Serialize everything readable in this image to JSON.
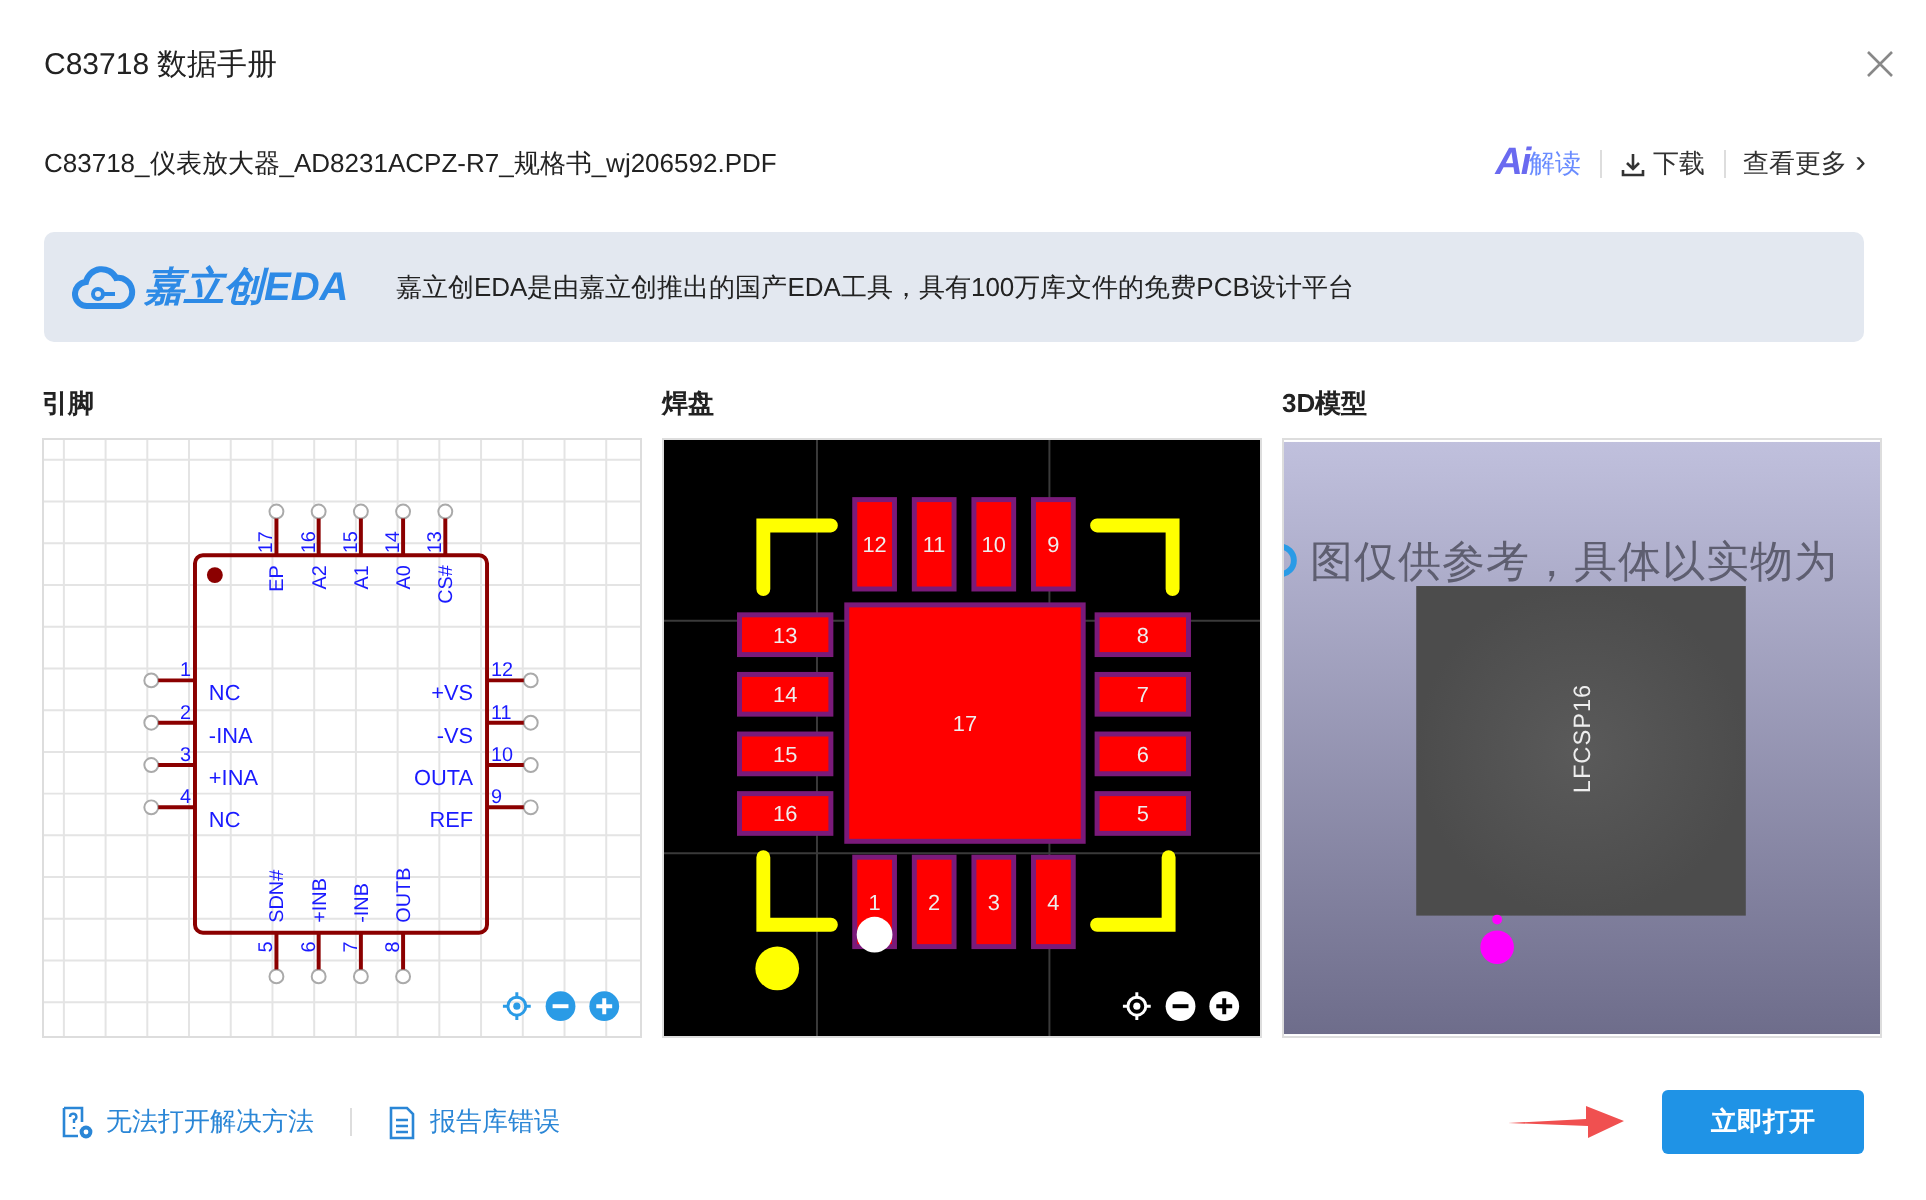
{
  "dialog": {
    "title": "C83718 数据手册"
  },
  "file": {
    "name": "C83718_仪表放大器_AD8231ACPZ-R7_规格书_wj206592.PDF",
    "actions": [
      {
        "kind": "ai",
        "label": "解读",
        "badge": "Ai"
      },
      {
        "kind": "download",
        "label": "下载"
      },
      {
        "kind": "more",
        "label": "查看更多",
        "chevron": "›"
      }
    ]
  },
  "banner": {
    "logo": "嘉立创EDA",
    "text": "嘉立创EDA是由嘉立创推出的国产EDA工具，具有100万库文件的免费PCB设计平台"
  },
  "panels": [
    {
      "kind": "schematic",
      "heading": "引脚",
      "pins": [
        {
          "number": "17",
          "name": "EP",
          "kind": "top"
        },
        {
          "number": "16",
          "name": "A2",
          "kind": "top"
        },
        {
          "number": "15",
          "name": "A1",
          "kind": "top"
        },
        {
          "number": "14",
          "name": "A0",
          "kind": "top"
        },
        {
          "number": "13",
          "name": "CS#",
          "kind": "top"
        },
        {
          "number": "1",
          "name": "NC",
          "kind": "left"
        },
        {
          "number": "2",
          "name": "-INA",
          "kind": "left"
        },
        {
          "number": "3",
          "name": "+INA",
          "kind": "left"
        },
        {
          "number": "4",
          "name": "NC",
          "kind": "left"
        },
        {
          "number": "12",
          "name": "+VS",
          "kind": "right"
        },
        {
          "number": "11",
          "name": "-VS",
          "kind": "right"
        },
        {
          "number": "10",
          "name": "OUTA",
          "kind": "right"
        },
        {
          "number": "9",
          "name": "REF",
          "kind": "right"
        },
        {
          "number": "5",
          "name": "SDN#",
          "kind": "bottom"
        },
        {
          "number": "6",
          "name": "+INB",
          "kind": "bottom"
        },
        {
          "number": "7",
          "name": "-INB",
          "kind": "bottom"
        },
        {
          "number": "8",
          "name": "OUTB",
          "kind": "bottom"
        }
      ]
    },
    {
      "kind": "footprint",
      "heading": "焊盘",
      "pads": [
        {
          "number": "12",
          "kind": "top"
        },
        {
          "number": "11",
          "kind": "top"
        },
        {
          "number": "10",
          "kind": "top"
        },
        {
          "number": "9",
          "kind": "top"
        },
        {
          "number": "13",
          "kind": "left"
        },
        {
          "number": "14",
          "kind": "left"
        },
        {
          "number": "15",
          "kind": "left"
        },
        {
          "number": "16",
          "kind": "left"
        },
        {
          "number": "8",
          "kind": "right"
        },
        {
          "number": "7",
          "kind": "right"
        },
        {
          "number": "6",
          "kind": "right"
        },
        {
          "number": "5",
          "kind": "right"
        },
        {
          "number": "1",
          "kind": "bottom"
        },
        {
          "number": "2",
          "kind": "bottom"
        },
        {
          "number": "3",
          "kind": "bottom"
        },
        {
          "number": "4",
          "kind": "bottom"
        },
        {
          "number": "17",
          "kind": "center"
        }
      ]
    },
    {
      "kind": "model",
      "heading": "3D模型",
      "notice": "图仅供参考，具体以实物为",
      "package": "LFCSP16"
    }
  ],
  "footer": {
    "links": [
      {
        "kind": "help",
        "label": "无法打开解决方法"
      },
      {
        "kind": "report",
        "label": "报告库错误"
      }
    ],
    "button": "立即打开"
  }
}
